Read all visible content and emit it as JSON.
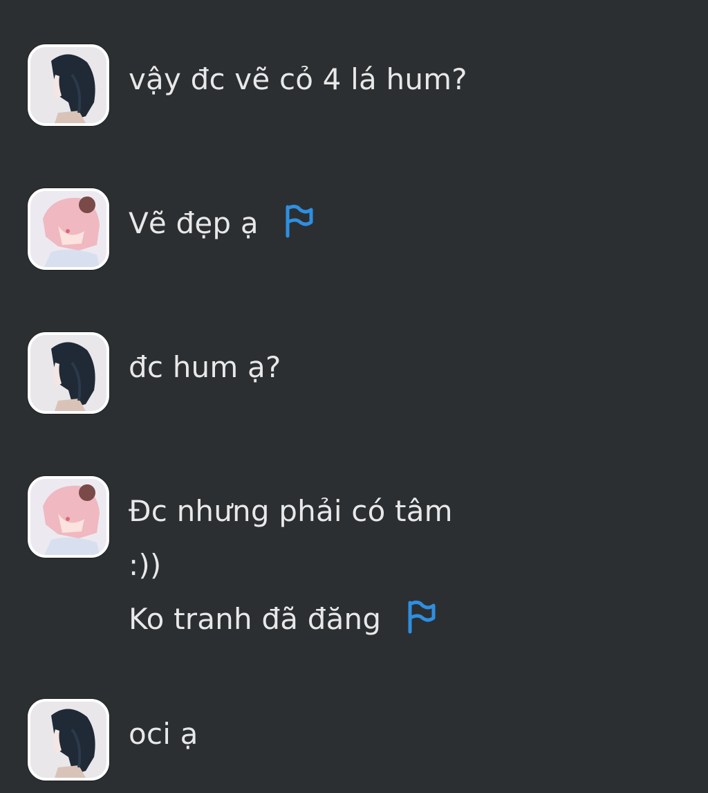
{
  "colors": {
    "background": "#2b2f32",
    "text": "#e8e8e8",
    "flag": "#2f8fe0"
  },
  "messages": [
    {
      "avatar": "dark-hair-avatar",
      "lines": [
        "vậy đc vẽ cỏ 4 lá hum?"
      ],
      "flag": false
    },
    {
      "avatar": "pink-hair-avatar",
      "lines": [
        "Vẽ đẹp ạ"
      ],
      "flag": true
    },
    {
      "avatar": "dark-hair-avatar",
      "lines": [
        "đc hum ạ?"
      ],
      "flag": false
    },
    {
      "avatar": "pink-hair-avatar",
      "lines": [
        "Đc nhưng phải có tâm",
        ":))",
        "Ko tranh đã đăng"
      ],
      "flag": true
    },
    {
      "avatar": "dark-hair-avatar",
      "lines": [
        "oci ạ"
      ],
      "flag": false
    }
  ]
}
